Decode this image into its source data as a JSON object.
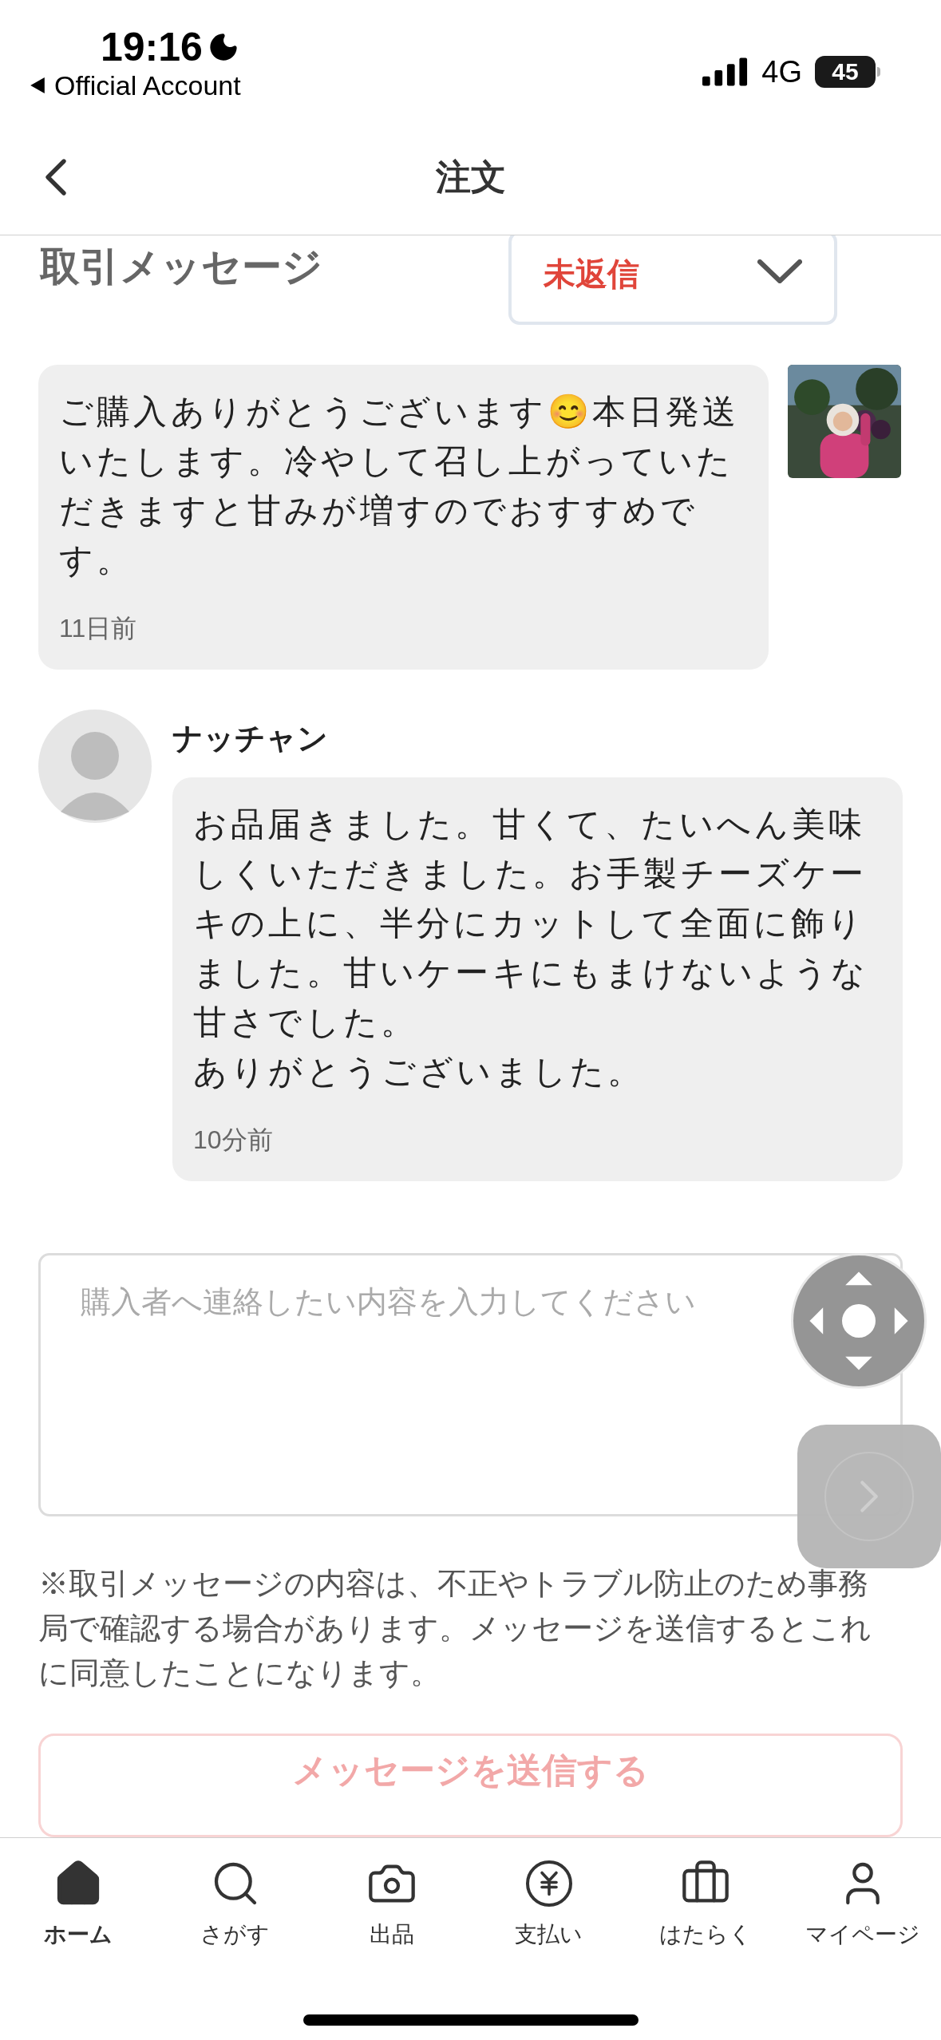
{
  "status_bar": {
    "time": "19:16",
    "back_label": "Official Account",
    "network": "4G",
    "battery": "45"
  },
  "header": {
    "title": "注文"
  },
  "section": {
    "title": "取引メッセージ",
    "filter": "未返信"
  },
  "messages": [
    {
      "kind": "seller",
      "text": "ご購入ありがとうございます😊本日発送いたします。冷やして召し上がっていただきますと甘みが増すのでおすすめです。",
      "time": "11日前"
    },
    {
      "kind": "buyer",
      "name": "ナッチャン",
      "text": "お品届きました。甘くて、たいへん美味しくいただきました。お手製チーズケーキの上に、半分にカットして全面に飾りました。甘いケーキにもまけないような甘さでした。",
      "text_2": "ありがとうございました。",
      "time": "10分前"
    }
  ],
  "composer": {
    "placeholder": "購入者へ連絡したい内容を入力してください"
  },
  "notice": "※取引メッセージの内容は、不正やトラブル防止のため事務局で確認する場合があります。メッセージを送信するとこれに同意したことになります。",
  "send_button": "メッセージを送信する",
  "tabs": [
    {
      "label": "ホーム",
      "kind": "home",
      "selected": true
    },
    {
      "label": "さがす",
      "kind": "search",
      "selected": false
    },
    {
      "label": "出品",
      "kind": "camera",
      "selected": false
    },
    {
      "label": "支払い",
      "kind": "yen",
      "selected": false
    },
    {
      "label": "はたらく",
      "kind": "work",
      "selected": false
    },
    {
      "label": "マイページ",
      "kind": "user",
      "selected": false
    }
  ]
}
